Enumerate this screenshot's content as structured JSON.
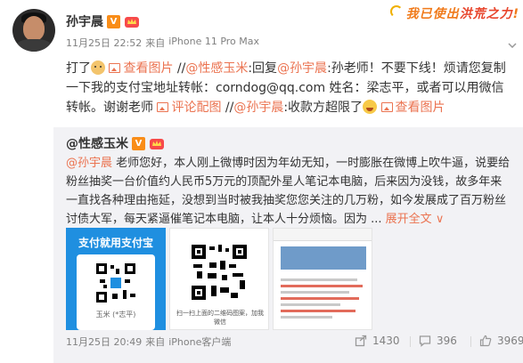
{
  "sticker": {
    "part1": "我已使出",
    "part2": "洪荒之力",
    "part3": "!"
  },
  "post": {
    "author": "孙宇晨",
    "time": "11月25日 22:52",
    "source_prefix": "来自",
    "source": "iPhone 11 Pro Max",
    "text": {
      "seg1": "打了",
      "view_image_1": "查看图片",
      "sep1": " //",
      "mention_1": "@性感玉米",
      "seg2": ":回复",
      "mention_2": "@孙宇晨",
      "seg3": ":孙老师！不要下线！烦请您复制一下我的支付宝地址转帐：corndog@qq.com 姓名：梁志平，或者可以用微信转帐。谢谢老师 ",
      "comment_image": "评论配图",
      "sep2": " //",
      "mention_3": "@孙宇晨",
      "seg4": ":收款方超限了",
      "view_image_2": "查看图片"
    }
  },
  "repost": {
    "author": "@性感玉米",
    "mention": "@孙宇晨",
    "text": " 老师您好，本人刚上微博时因为年幼无知，一时膨胀在微博上吹牛逼，说要给粉丝抽奖一台价值约人民币5万元的顶配外星人笔记本电脑，后来因为没钱，故多年来一直找各种理由拖延，没想到当时被我抽奖您您关注的几万粉，如今发展成了百万粉丝讨债大军，每天紧逼催笔记本电脑，让本人十分烦恼。因为 ...",
    "expand": "展开全文",
    "expand_arrow": "∨",
    "images": {
      "alipay_title": "支付就用支付宝",
      "alipay_caption": "玉米 (*志平)",
      "wechat_caption": "扫一扫上面的二维码图案，加我微信"
    }
  },
  "footer": {
    "time": "11月25日 20:49",
    "source_prefix": "来自",
    "source": "iPhone客户端",
    "shares": "1430",
    "comments": "396",
    "likes": "3969"
  },
  "colors": {
    "link": "#eb7350",
    "repost_bg": "#f2f2f5",
    "verified": "#f98d18"
  }
}
